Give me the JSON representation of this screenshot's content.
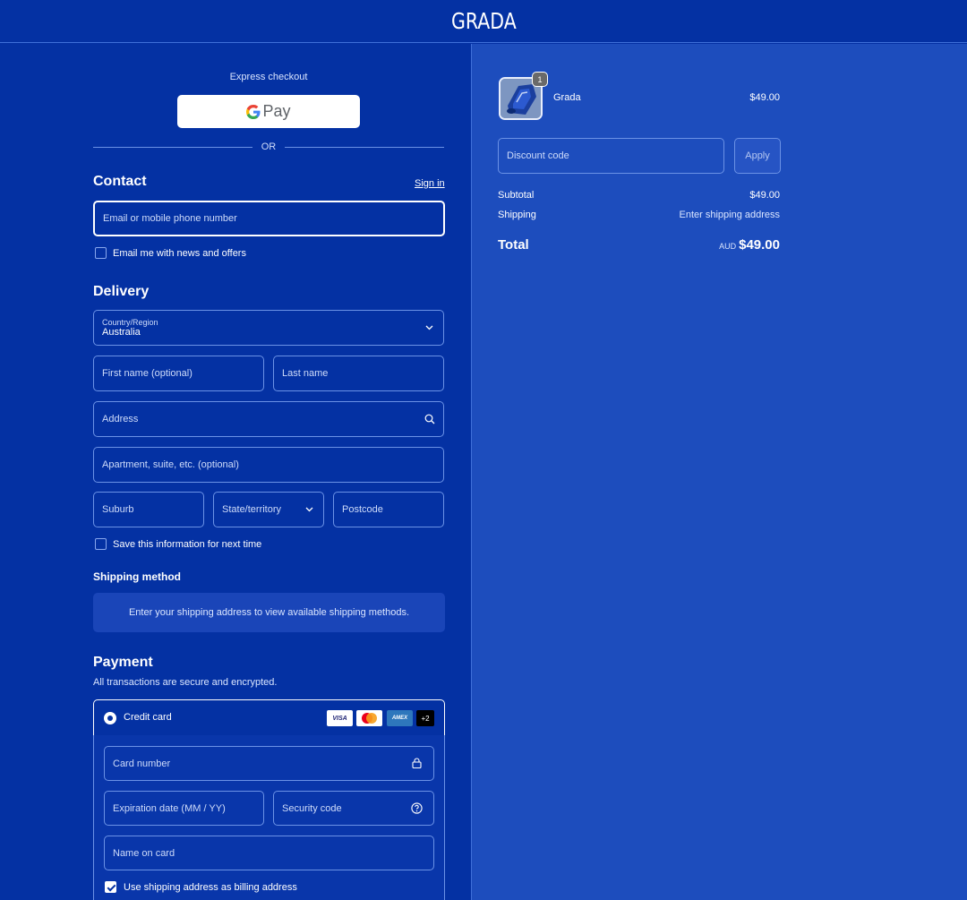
{
  "header": {
    "logo": "GRADA"
  },
  "express": {
    "title": "Express checkout",
    "gpay_label": "Pay",
    "or": "OR"
  },
  "contact": {
    "title": "Contact",
    "sign_in": "Sign in",
    "email_placeholder": "Email or mobile phone number",
    "news_label": "Email me with news and offers"
  },
  "delivery": {
    "title": "Delivery",
    "country_label": "Country/Region",
    "country_value": "Australia",
    "first_name": "First name (optional)",
    "last_name": "Last name",
    "address": "Address",
    "apartment": "Apartment, suite, etc. (optional)",
    "suburb": "Suburb",
    "state": "State/territory",
    "postcode": "Postcode",
    "save_info": "Save this information for next time"
  },
  "shipping_method": {
    "title": "Shipping method",
    "message": "Enter your shipping address to view available shipping methods."
  },
  "payment": {
    "title": "Payment",
    "subtitle": "All transactions are secure and encrypted.",
    "credit_card": "Credit card",
    "card_brands": [
      "VISA",
      "AMEX"
    ],
    "more_brands": "+2",
    "card_number": "Card number",
    "expiry": "Expiration date (MM / YY)",
    "security_code": "Security code",
    "name_on_card": "Name on card",
    "billing_same": "Use shipping address as billing address"
  },
  "summary": {
    "item_name": "Grada",
    "item_qty": "1",
    "item_price": "$49.00",
    "discount_placeholder": "Discount code",
    "apply": "Apply",
    "subtotal_label": "Subtotal",
    "subtotal_value": "$49.00",
    "shipping_label": "Shipping",
    "shipping_value": "Enter shipping address",
    "total_label": "Total",
    "currency": "AUD",
    "total_value": "$49.00"
  },
  "colors": {
    "left_bg": "#0431a3",
    "right_bg": "#1d4dbd",
    "field_border": "#6b92e6",
    "accent": "#ffffff"
  }
}
